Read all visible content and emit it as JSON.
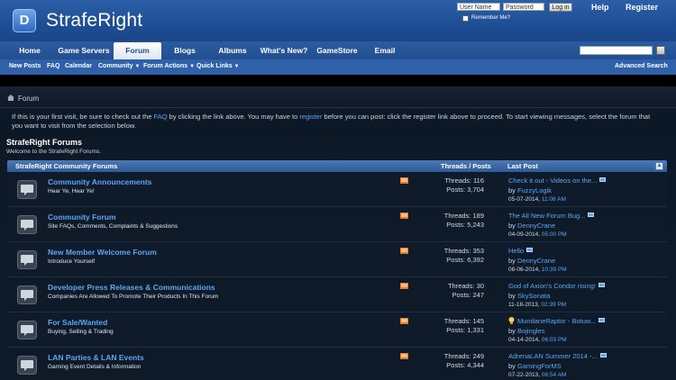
{
  "header": {
    "logo_letter": "D",
    "site_name": "StrafeRight",
    "login": {
      "username_placeholder": "User Name",
      "password_placeholder": "Password",
      "login_button": "Log in",
      "remember_label": "Remember Me?"
    },
    "help": "Help",
    "register": "Register"
  },
  "nav": {
    "tabs": [
      {
        "label": "Home"
      },
      {
        "label": "Game Servers"
      },
      {
        "label": "Forum"
      },
      {
        "label": "Blogs"
      },
      {
        "label": "Albums"
      },
      {
        "label": "What's New?"
      },
      {
        "label": "GameStore"
      },
      {
        "label": "Email"
      }
    ],
    "active_tab": "Forum"
  },
  "subnav": {
    "items": [
      "New Posts",
      "FAQ",
      "Calendar",
      "Community",
      "Forum Actions",
      "Quick Links"
    ],
    "advanced_search": "Advanced Search"
  },
  "breadcrumb": "Forum",
  "notice": {
    "p1": "If this is your first visit, be sure to check out the ",
    "faq": "FAQ",
    "p2": " by clicking the link above. You may have to ",
    "register": "register",
    "p3": " before you can post: click the register link above to proceed. To start viewing messages, select the forum that you want to visit from the selection below."
  },
  "forums_title": "StrafeRight Forums",
  "forums_subtitle": "Welcome to the StrafeRight Forums.",
  "table": {
    "heading": "StrafeRight Community Forums",
    "col_threads_posts": "Threads / Posts",
    "col_last_post": "Last Post",
    "rows": [
      {
        "title": "Community Announcements",
        "desc": "Hear Ye, Hear Ye!",
        "threads": "Threads: 116",
        "posts": "Posts: 3,704",
        "lp_title": "Check it out - Videos on the...",
        "by": "by ",
        "user": "FuzzyLogik",
        "date": "05-07-2014, ",
        "time": "11:08 AM",
        "bulb": false
      },
      {
        "title": "Community Forum",
        "desc": "Site FAQs, Comments, Complaints & Suggestions",
        "threads": "Threads: 189",
        "posts": "Posts: 5,243",
        "lp_title": "The All New Forum Bug...",
        "by": "by ",
        "user": "DennyCrane",
        "date": "04-09-2014, ",
        "time": "05:00 PM",
        "bulb": false
      },
      {
        "title": "New Member Welcome Forum",
        "desc": "Introduce Yourself",
        "threads": "Threads: 353",
        "posts": "Posts: 6,392",
        "lp_title": "Hello",
        "by": "by ",
        "user": "DennyCrane",
        "date": "08-06-2014, ",
        "time": "10:39 PM",
        "bulb": false
      },
      {
        "title": "Developer Press Releases & Communications",
        "desc": "Companies Are Allowed To Promote Their Products In This Forum",
        "threads": "Threads: 30",
        "posts": "Posts: 247",
        "lp_title": "God of Axion's Condor rising!",
        "by": "by ",
        "user": "SkySonata",
        "date": "11-18-2013, ",
        "time": "02:39 PM",
        "bulb": false
      },
      {
        "title": "For Sale/Wanted",
        "desc": "Buying, Selling & Trading",
        "threads": "Threads: 145",
        "posts": "Posts: 1,331",
        "lp_title": "MundaneRaptor - Botuw...",
        "by": "by ",
        "user": "Bojingles",
        "date": "04-14-2014, ",
        "time": "06:03 PM",
        "bulb": true
      },
      {
        "title": "LAN Parties & LAN Events",
        "desc": "Gaming Event Details & Information",
        "threads": "Threads: 249",
        "posts": "Posts: 4,344",
        "lp_title": "AdrenaLAN Summer 2014 -...",
        "by": "by ",
        "user": "GamingForMS",
        "date": "07-22-2013, ",
        "time": "08:54 AM",
        "bulb": false
      }
    ]
  }
}
